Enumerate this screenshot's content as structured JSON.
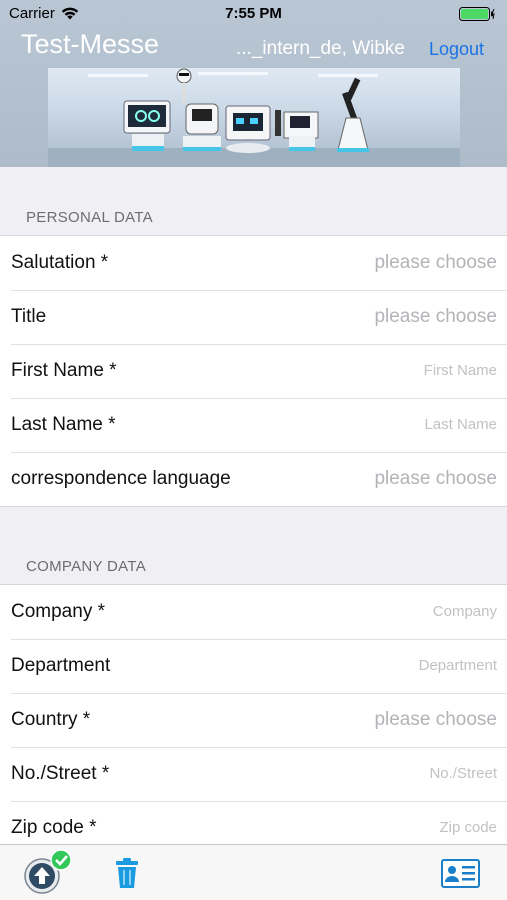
{
  "status_bar": {
    "carrier": "Carrier",
    "time": "7:55 PM",
    "wifi_icon": "wifi-icon",
    "battery_icon": "battery-icon"
  },
  "nav": {
    "title": "Test-Messe",
    "user": "..._intern_de, Wibke",
    "logout": "Logout"
  },
  "banner": {
    "image": "robots-showroom-banner"
  },
  "personal": {
    "header": "PERSONAL DATA",
    "rows": [
      {
        "label": "Salutation *",
        "value": "please choose"
      },
      {
        "label": "Title",
        "value": "please choose"
      },
      {
        "label": "First Name *",
        "value": "First Name"
      },
      {
        "label": "Last Name *",
        "value": "Last Name"
      },
      {
        "label": "correspondence language",
        "value": "please choose"
      }
    ]
  },
  "company": {
    "header": "COMPANY DATA",
    "rows": [
      {
        "label": "Company *",
        "value": "Company"
      },
      {
        "label": "Department",
        "value": "Department"
      },
      {
        "label": "Country *",
        "value": "please choose"
      },
      {
        "label": "No./Street *",
        "value": "No./Street"
      },
      {
        "label": "Zip code *",
        "value": "Zip code"
      }
    ]
  },
  "toolbar": {
    "upload_icon": "upload-check-icon",
    "trash_icon": "trash-icon",
    "card_icon": "contact-card-icon"
  },
  "colors": {
    "header_bg": "#b9c6d4",
    "link": "#1a73e8",
    "placeholder": "#b3b3b8",
    "section_bg": "#efeff4",
    "check_green": "#34c759"
  }
}
